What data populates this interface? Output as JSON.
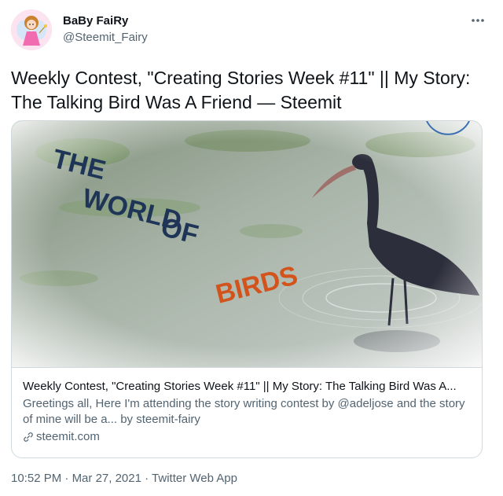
{
  "author": {
    "name": "BaBy FaiRy",
    "handle": "@Steemit_Fairy"
  },
  "tweet": {
    "text": "Weekly Contest, \"Creating Stories Week #11\" || My Story: The Talking Bird Was A Friend — Steemit"
  },
  "card": {
    "image_text": [
      "THE",
      "WORLD",
      "OF",
      "BIRDS"
    ],
    "title": "Weekly Contest, \"Creating Stories Week #11\" || My Story: The Talking Bird Was A...",
    "description": "Greetings all, Here I'm attending the story writing contest by @adeljose and the story of mine will be a... by steemit-fairy",
    "domain": "steemit.com"
  },
  "footer": {
    "time": "10:52 PM",
    "date": "Mar 27, 2021",
    "source": "Twitter Web App"
  },
  "colors": {
    "text_primary": "#0f1419",
    "text_secondary": "#536471",
    "border": "#cfd9de",
    "image_title_navy": "#1f3557",
    "image_title_orange": "#d2541c"
  },
  "icons": {
    "more": "more-horizontal-icon",
    "link": "link-icon"
  }
}
